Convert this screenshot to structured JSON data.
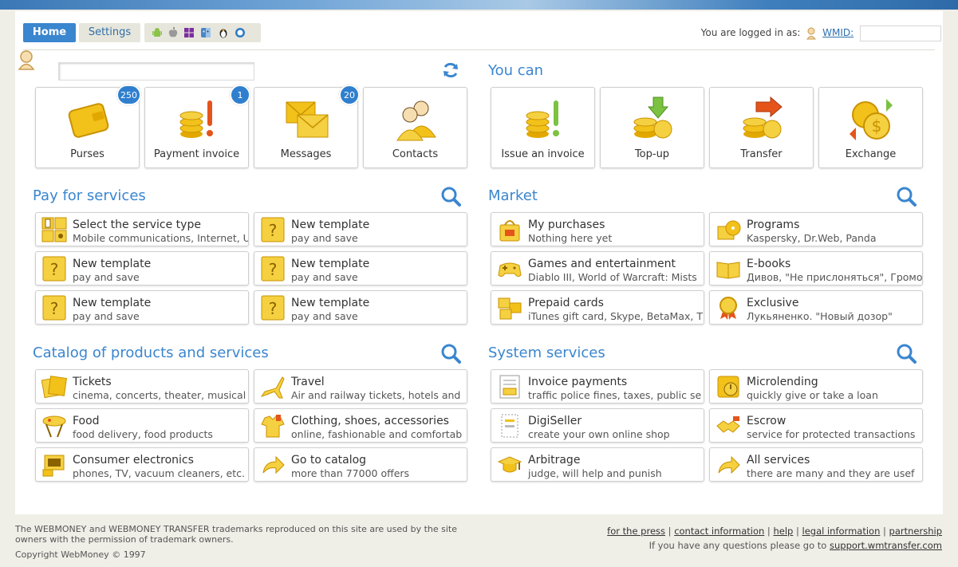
{
  "nav": {
    "home": "Home",
    "settings": "Settings",
    "login_text": "You are logged in as:",
    "wmid_label": "WMID:"
  },
  "you_can_title": "You can",
  "top_tiles": [
    {
      "label": "Purses",
      "badge": "250"
    },
    {
      "label": "Payment invoice",
      "badge": "1"
    },
    {
      "label": "Messages",
      "badge": "20"
    },
    {
      "label": "Contacts",
      "badge": ""
    }
  ],
  "you_can_tiles": [
    {
      "label": "Issue an invoice"
    },
    {
      "label": "Top-up"
    },
    {
      "label": "Transfer"
    },
    {
      "label": "Exchange"
    }
  ],
  "pay_for_services": {
    "title": "Pay for services",
    "items": [
      {
        "title": "Select the service type",
        "sub": "Mobile communications, Internet, U"
      },
      {
        "title": "New template",
        "sub": "pay and save"
      },
      {
        "title": "New template",
        "sub": "pay and save"
      },
      {
        "title": "New template",
        "sub": "pay and save"
      },
      {
        "title": "New template",
        "sub": "pay and save"
      },
      {
        "title": "New template",
        "sub": "pay and save"
      }
    ]
  },
  "market": {
    "title": "Market",
    "items": [
      {
        "title": "My purchases",
        "sub": "Nothing here yet"
      },
      {
        "title": "Programs",
        "sub": "Kaspersky, Dr.Web, Panda"
      },
      {
        "title": "Games and entertainment",
        "sub": "Diablo III, World of Warcraft: Mists"
      },
      {
        "title": "E-books",
        "sub": "Дивов, \"Не прислоняться\", Громо"
      },
      {
        "title": "Prepaid cards",
        "sub": "iTunes gift card, Skype, BetaMax, T"
      },
      {
        "title": "Exclusive",
        "sub": "Лукьяненко. \"Новый дозор\""
      }
    ]
  },
  "catalog": {
    "title": "Catalog of products and services",
    "items": [
      {
        "title": "Tickets",
        "sub": "cinema, concerts, theater, musical"
      },
      {
        "title": "Travel",
        "sub": "Air and railway tickets, hotels and"
      },
      {
        "title": "Food",
        "sub": "food delivery, food products"
      },
      {
        "title": "Clothing, shoes, accessories",
        "sub": "online, fashionable and comfortab"
      },
      {
        "title": "Consumer electronics",
        "sub": "phones, TV, vacuum cleaners, etc."
      },
      {
        "title": "Go to catalog",
        "sub": "more than 77000 offers"
      }
    ]
  },
  "system_services": {
    "title": "System services",
    "items": [
      {
        "title": "Invoice payments",
        "sub": "traffic police fines, taxes, public se"
      },
      {
        "title": "Microlending",
        "sub": "quickly give or take a loan"
      },
      {
        "title": "DigiSeller",
        "sub": "create your own online shop"
      },
      {
        "title": "Escrow",
        "sub": "service for protected transactions"
      },
      {
        "title": "Arbitrage",
        "sub": "judge, will help and punish"
      },
      {
        "title": "All services",
        "sub": "there are many and they are usef"
      }
    ]
  },
  "footer": {
    "trademark": "The WEBMONEY and WEBMONEY TRANSFER trademarks reproduced on this site are used by the site owners with the permission of trademark owners.",
    "copyright": "Copyright WebMoney © 1997",
    "links": [
      "for the press",
      "contact information",
      "help",
      "legal information",
      "partnership"
    ],
    "question_text": "If you have any questions please go to",
    "support_link": "support.wmtransfer.com"
  },
  "colors": {
    "accent": "#3a86cf",
    "gold": "#f2c11a",
    "badge": "#2f7fce"
  }
}
